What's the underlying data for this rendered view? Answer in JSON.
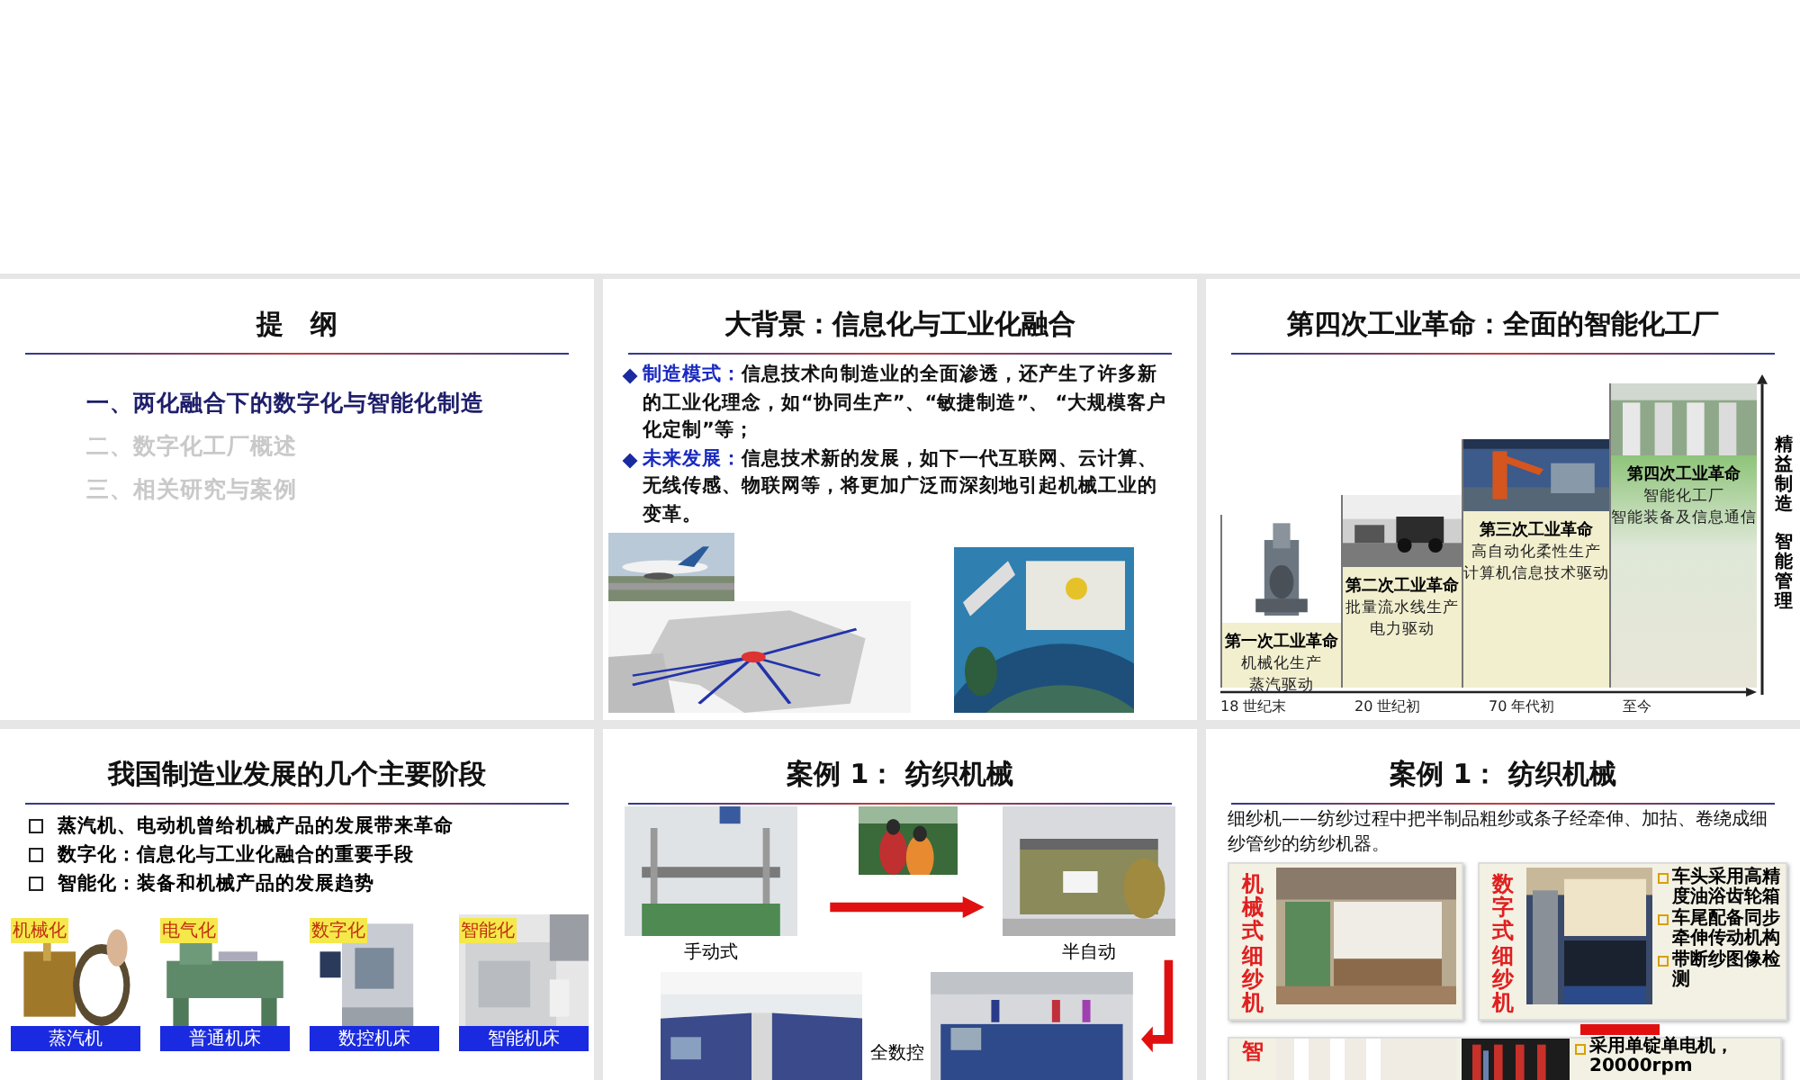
{
  "slides": [
    {
      "kind": "outline",
      "title": "提　纲",
      "items": [
        {
          "text": "一、两化融合下的数字化与智能化制造",
          "selected": true
        },
        {
          "text": "二、数字化工厂概述",
          "selected": false
        },
        {
          "text": "三、相关研究与案例",
          "selected": false
        }
      ]
    },
    {
      "kind": "background",
      "title": "大背景：信息化与工业化融合",
      "bullets": [
        {
          "label": "制造模式：",
          "text": "信息技术向制造业的全面渗透，还产生了许多新的工业化理念，如“协同生产”、“敏捷制造”、 “大规模客户化定制”等；"
        },
        {
          "label": "未来发展：",
          "text": "信息技术新的发展，如下一代互联网、云计算、无线传感、物联网等，将更加广泛而深刻地引起机械工业的变革。"
        }
      ]
    },
    {
      "kind": "timeline",
      "title": "第四次工业革命：全面的智能化工厂",
      "steps": [
        {
          "name": "第一次工业革命",
          "lines": [
            "机械化生产",
            "蒸汽驱动"
          ],
          "era": "18 世纪末"
        },
        {
          "name": "第二次工业革命",
          "lines": [
            "批量流水线生产",
            "电力驱动"
          ],
          "era": "20 世纪初"
        },
        {
          "name": "第三次工业革命",
          "lines": [
            "高自动化柔性生产",
            "计算机信息技术驱动"
          ],
          "era": "70 年代初"
        },
        {
          "name": "第四次工业革命",
          "lines": [
            "智能化工厂",
            "智能装备及信息通信"
          ],
          "era": "至今"
        }
      ],
      "side_labels": [
        "精益制造",
        "智能管理"
      ]
    },
    {
      "kind": "stages",
      "title": "我国制造业发展的几个主要阶段",
      "bullets": [
        "蒸汽机、电动机曾给机械产品的发展带来革命",
        "数字化：信息化与工业化融合的重要手段",
        "智能化：装备和机械产品的发展趋势"
      ],
      "stages": [
        {
          "tag": "机械化",
          "caption": "蒸汽机"
        },
        {
          "tag": "电气化",
          "caption": "普通机床"
        },
        {
          "tag": "数字化",
          "caption": "数控机床"
        },
        {
          "tag": "智能化",
          "caption": "智能机床"
        }
      ]
    },
    {
      "kind": "textile",
      "title": "案例 1： 纺织机械",
      "captions": [
        "手动式",
        "半自动",
        "全数控"
      ]
    },
    {
      "kind": "spinning",
      "title": "案例 1： 纺织机械",
      "intro": "细纱机——纺纱过程中把半制品粗纱或条子经牵伸、加拈、卷绕成细纱管纱的纺纱机器。",
      "panels": [
        {
          "label": "机械式细纱机"
        },
        {
          "label": "数字式细纱机",
          "notes": [
            "车头采用高精度油浴齿轮箱",
            "车尾配备同步牵伸传动机构",
            "带断纱图像检测"
          ]
        },
        {
          "label": "智",
          "notes": [
            "采用单锭单电机，20000rpm"
          ]
        }
      ]
    }
  ]
}
